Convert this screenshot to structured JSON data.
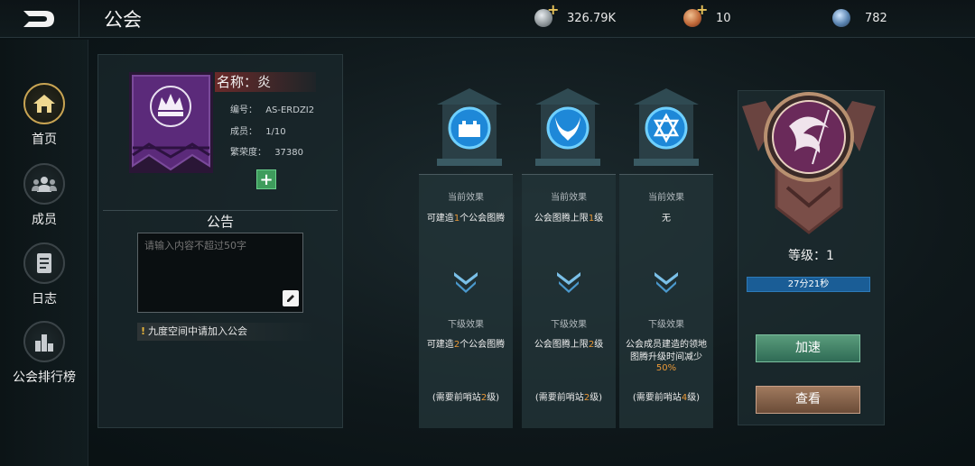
{
  "header": {
    "title": "公会",
    "resources": [
      {
        "icon": "silver-coin-icon",
        "value": "326.79K",
        "has_add": true
      },
      {
        "icon": "bronze-token-icon",
        "value": "10",
        "has_add": true
      },
      {
        "icon": "crystal-orb-icon",
        "value": "782",
        "has_add": false
      }
    ]
  },
  "sidebar": {
    "items": [
      {
        "label": "首页",
        "icon": "home-icon",
        "active": true
      },
      {
        "label": "成员",
        "icon": "members-icon",
        "active": false
      },
      {
        "label": "日志",
        "icon": "log-icon",
        "active": false
      },
      {
        "label": "公会排行榜",
        "icon": "ranking-icon",
        "active": false
      }
    ]
  },
  "guild": {
    "name_label": "名称：炎",
    "id_label": "编号：",
    "id_value": "AS-ERDZI2",
    "members_label": "成员：",
    "members_value": "1/10",
    "prosperity_label": "繁荣度：",
    "prosperity_value": "37380"
  },
  "notice": {
    "title": "公告",
    "placeholder": "请输入内容不超过50字",
    "hint": "九度空间中请加入公会"
  },
  "effects": [
    {
      "icon": "castle-icon",
      "current_label": "当前效果",
      "current_pre": "可建造",
      "current_num": "1",
      "current_post": "个公会图腾",
      "next_label": "下级效果",
      "next_pre": "可建造",
      "next_num": "2",
      "next_post": "个公会图腾",
      "req_pre": "(需要前哨站",
      "req_num": "2",
      "req_post": "级)"
    },
    {
      "icon": "flame-horns-icon",
      "current_label": "当前效果",
      "current_pre": "公会图腾上限",
      "current_num": "1",
      "current_post": "级",
      "next_label": "下级效果",
      "next_pre": "公会图腾上限",
      "next_num": "2",
      "next_post": "级",
      "req_pre": "(需要前哨站",
      "req_num": "2",
      "req_post": "级)"
    },
    {
      "icon": "hexagram-icon",
      "current_label": "当前效果",
      "current_pre": "无",
      "current_num": "",
      "current_post": "",
      "next_label": "下级效果",
      "next_text": "公会成员建造的领地图腾升级时间减少",
      "next_pct": "50%",
      "req_pre": "(需要前哨站",
      "req_num": "4",
      "req_post": "级)"
    }
  ],
  "level": {
    "label": "等级：1",
    "timer": "27分21秒",
    "speed_button": "加速",
    "view_button": "查看"
  },
  "colors": {
    "accent_orange": "#e89838",
    "timer_blue": "#1a5d96",
    "speed_green": "#3f8266",
    "view_brown": "#86624a",
    "banner_purple": "#5b2a7a"
  }
}
